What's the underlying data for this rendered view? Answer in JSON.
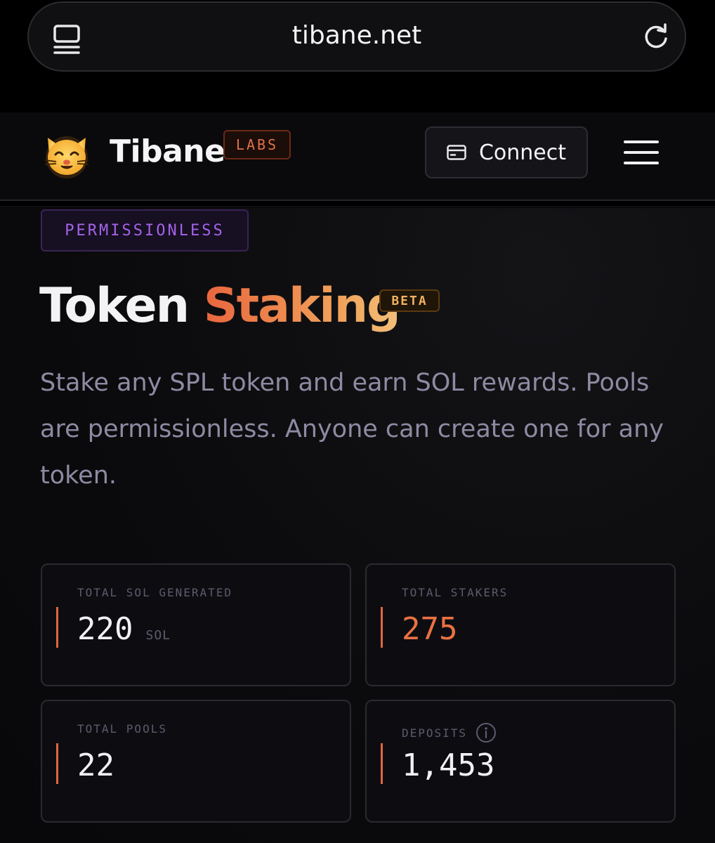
{
  "browser": {
    "url": "tibane.net"
  },
  "header": {
    "brand": "Tibane",
    "brand_badge": "LABS",
    "connect_label": "Connect"
  },
  "hero": {
    "badge": "PERMISSIONLESS",
    "title_part1": "Token",
    "title_part2": "Staking",
    "beta_badge": "BETA",
    "subtitle": "Stake any SPL token and earn SOL rewards. Pools are permissionless. Anyone can create one for any token."
  },
  "stats": [
    {
      "label": "TOTAL SOL GENERATED",
      "value": "220",
      "unit": "SOL"
    },
    {
      "label": "TOTAL STAKERS",
      "value": "275"
    },
    {
      "label": "TOTAL POOLS",
      "value": "22"
    },
    {
      "label": "DEPOSITS",
      "value": "1,453"
    }
  ],
  "colors": {
    "accent_orange": "#e0673c",
    "purple": "#a463ea",
    "background": "#0a0a0c"
  }
}
